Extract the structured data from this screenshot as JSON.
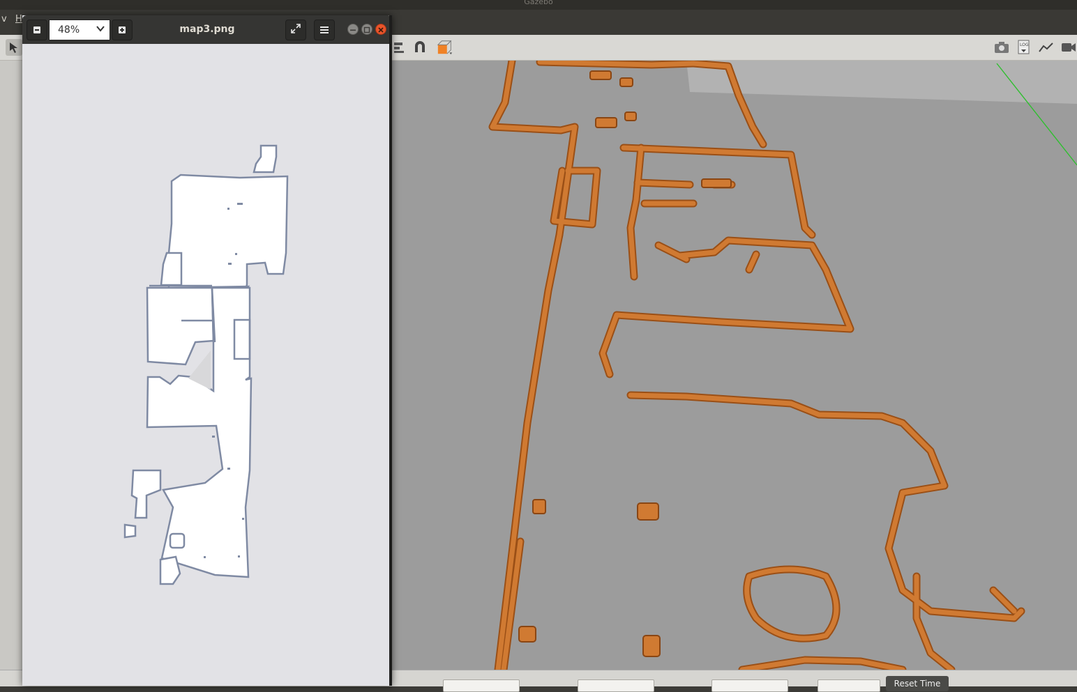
{
  "gazebo": {
    "title": "Gazebo",
    "menu": {
      "view_fragment": "v",
      "help_fragment": "H"
    },
    "toolbar_icons": [
      "select-arrow-icon",
      "align-icon",
      "magnet-icon",
      "color-cube-icon",
      "screenshot-icon",
      "log-icon",
      "plot-icon",
      "video-record-icon"
    ],
    "accent_orange": "#f08226",
    "reset_time_label": "Reset Time"
  },
  "viewer": {
    "title": "map3.png",
    "zoom": "48%",
    "header_color": "#353533",
    "map_outline_color": "#7f8aa3",
    "map_free_color": "#ffffff",
    "map_unknown_color": "#e2e2e6"
  },
  "scene": {
    "floor_color": "#9c9c9c",
    "wall_color": "#d07a32",
    "axis_green": "#2fbf2f"
  }
}
